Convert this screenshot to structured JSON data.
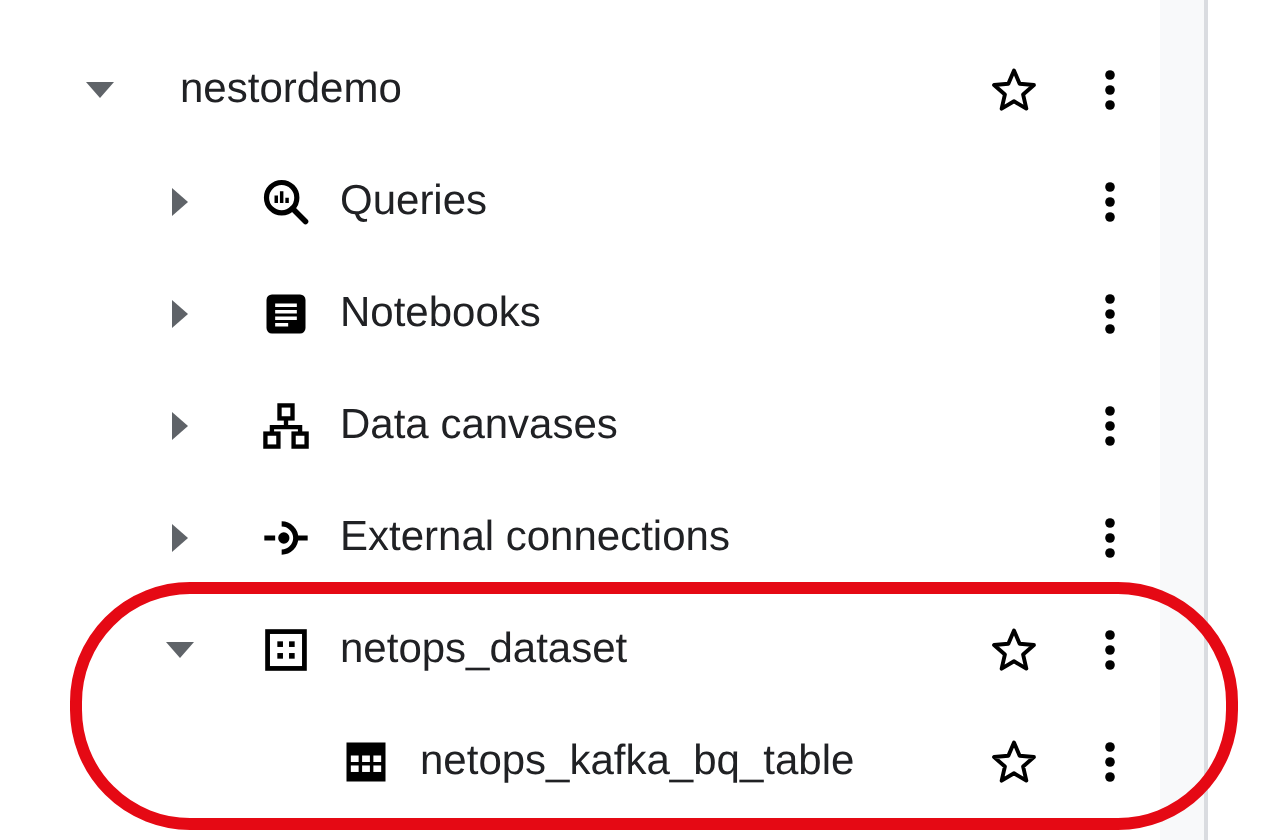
{
  "tree": [
    {
      "label": "nestordemo",
      "expanded": true,
      "star": true,
      "highlighted": false,
      "children": [
        {
          "label": "Queries",
          "kind": "queries",
          "expanded": false,
          "star": false,
          "highlighted": false
        },
        {
          "label": "Notebooks",
          "kind": "notebooks",
          "expanded": false,
          "star": false,
          "highlighted": false
        },
        {
          "label": "Data canvases",
          "kind": "canvases",
          "expanded": false,
          "star": false,
          "highlighted": false
        },
        {
          "label": "External connections",
          "kind": "connections",
          "expanded": false,
          "star": false,
          "highlighted": false
        },
        {
          "label": "netops_dataset",
          "kind": "dataset",
          "expanded": true,
          "star": true,
          "highlighted": true,
          "children": [
            {
              "label": "netops_kafka_bq_table",
              "kind": "table",
              "star": true,
              "highlighted": false
            }
          ]
        }
      ]
    }
  ]
}
